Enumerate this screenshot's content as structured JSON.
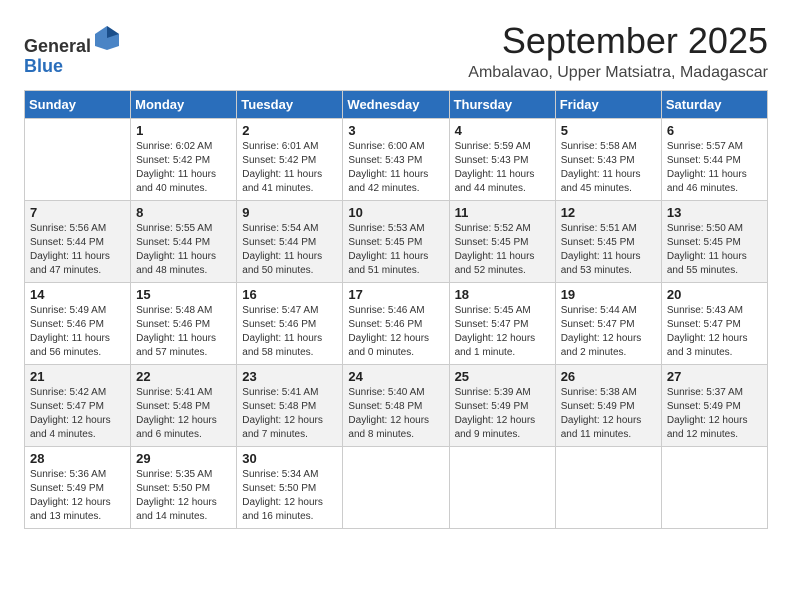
{
  "header": {
    "logo_line1": "General",
    "logo_line2": "Blue",
    "month": "September 2025",
    "location": "Ambalavao, Upper Matsiatra, Madagascar"
  },
  "weekdays": [
    "Sunday",
    "Monday",
    "Tuesday",
    "Wednesday",
    "Thursday",
    "Friday",
    "Saturday"
  ],
  "weeks": [
    [
      {
        "day": "",
        "info": ""
      },
      {
        "day": "1",
        "info": "Sunrise: 6:02 AM\nSunset: 5:42 PM\nDaylight: 11 hours\nand 40 minutes."
      },
      {
        "day": "2",
        "info": "Sunrise: 6:01 AM\nSunset: 5:42 PM\nDaylight: 11 hours\nand 41 minutes."
      },
      {
        "day": "3",
        "info": "Sunrise: 6:00 AM\nSunset: 5:43 PM\nDaylight: 11 hours\nand 42 minutes."
      },
      {
        "day": "4",
        "info": "Sunrise: 5:59 AM\nSunset: 5:43 PM\nDaylight: 11 hours\nand 44 minutes."
      },
      {
        "day": "5",
        "info": "Sunrise: 5:58 AM\nSunset: 5:43 PM\nDaylight: 11 hours\nand 45 minutes."
      },
      {
        "day": "6",
        "info": "Sunrise: 5:57 AM\nSunset: 5:44 PM\nDaylight: 11 hours\nand 46 minutes."
      }
    ],
    [
      {
        "day": "7",
        "info": "Sunrise: 5:56 AM\nSunset: 5:44 PM\nDaylight: 11 hours\nand 47 minutes."
      },
      {
        "day": "8",
        "info": "Sunrise: 5:55 AM\nSunset: 5:44 PM\nDaylight: 11 hours\nand 48 minutes."
      },
      {
        "day": "9",
        "info": "Sunrise: 5:54 AM\nSunset: 5:44 PM\nDaylight: 11 hours\nand 50 minutes."
      },
      {
        "day": "10",
        "info": "Sunrise: 5:53 AM\nSunset: 5:45 PM\nDaylight: 11 hours\nand 51 minutes."
      },
      {
        "day": "11",
        "info": "Sunrise: 5:52 AM\nSunset: 5:45 PM\nDaylight: 11 hours\nand 52 minutes."
      },
      {
        "day": "12",
        "info": "Sunrise: 5:51 AM\nSunset: 5:45 PM\nDaylight: 11 hours\nand 53 minutes."
      },
      {
        "day": "13",
        "info": "Sunrise: 5:50 AM\nSunset: 5:45 PM\nDaylight: 11 hours\nand 55 minutes."
      }
    ],
    [
      {
        "day": "14",
        "info": "Sunrise: 5:49 AM\nSunset: 5:46 PM\nDaylight: 11 hours\nand 56 minutes."
      },
      {
        "day": "15",
        "info": "Sunrise: 5:48 AM\nSunset: 5:46 PM\nDaylight: 11 hours\nand 57 minutes."
      },
      {
        "day": "16",
        "info": "Sunrise: 5:47 AM\nSunset: 5:46 PM\nDaylight: 11 hours\nand 58 minutes."
      },
      {
        "day": "17",
        "info": "Sunrise: 5:46 AM\nSunset: 5:46 PM\nDaylight: 12 hours\nand 0 minutes."
      },
      {
        "day": "18",
        "info": "Sunrise: 5:45 AM\nSunset: 5:47 PM\nDaylight: 12 hours\nand 1 minute."
      },
      {
        "day": "19",
        "info": "Sunrise: 5:44 AM\nSunset: 5:47 PM\nDaylight: 12 hours\nand 2 minutes."
      },
      {
        "day": "20",
        "info": "Sunrise: 5:43 AM\nSunset: 5:47 PM\nDaylight: 12 hours\nand 3 minutes."
      }
    ],
    [
      {
        "day": "21",
        "info": "Sunrise: 5:42 AM\nSunset: 5:47 PM\nDaylight: 12 hours\nand 4 minutes."
      },
      {
        "day": "22",
        "info": "Sunrise: 5:41 AM\nSunset: 5:48 PM\nDaylight: 12 hours\nand 6 minutes."
      },
      {
        "day": "23",
        "info": "Sunrise: 5:41 AM\nSunset: 5:48 PM\nDaylight: 12 hours\nand 7 minutes."
      },
      {
        "day": "24",
        "info": "Sunrise: 5:40 AM\nSunset: 5:48 PM\nDaylight: 12 hours\nand 8 minutes."
      },
      {
        "day": "25",
        "info": "Sunrise: 5:39 AM\nSunset: 5:49 PM\nDaylight: 12 hours\nand 9 minutes."
      },
      {
        "day": "26",
        "info": "Sunrise: 5:38 AM\nSunset: 5:49 PM\nDaylight: 12 hours\nand 11 minutes."
      },
      {
        "day": "27",
        "info": "Sunrise: 5:37 AM\nSunset: 5:49 PM\nDaylight: 12 hours\nand 12 minutes."
      }
    ],
    [
      {
        "day": "28",
        "info": "Sunrise: 5:36 AM\nSunset: 5:49 PM\nDaylight: 12 hours\nand 13 minutes."
      },
      {
        "day": "29",
        "info": "Sunrise: 5:35 AM\nSunset: 5:50 PM\nDaylight: 12 hours\nand 14 minutes."
      },
      {
        "day": "30",
        "info": "Sunrise: 5:34 AM\nSunset: 5:50 PM\nDaylight: 12 hours\nand 16 minutes."
      },
      {
        "day": "",
        "info": ""
      },
      {
        "day": "",
        "info": ""
      },
      {
        "day": "",
        "info": ""
      },
      {
        "day": "",
        "info": ""
      }
    ]
  ]
}
